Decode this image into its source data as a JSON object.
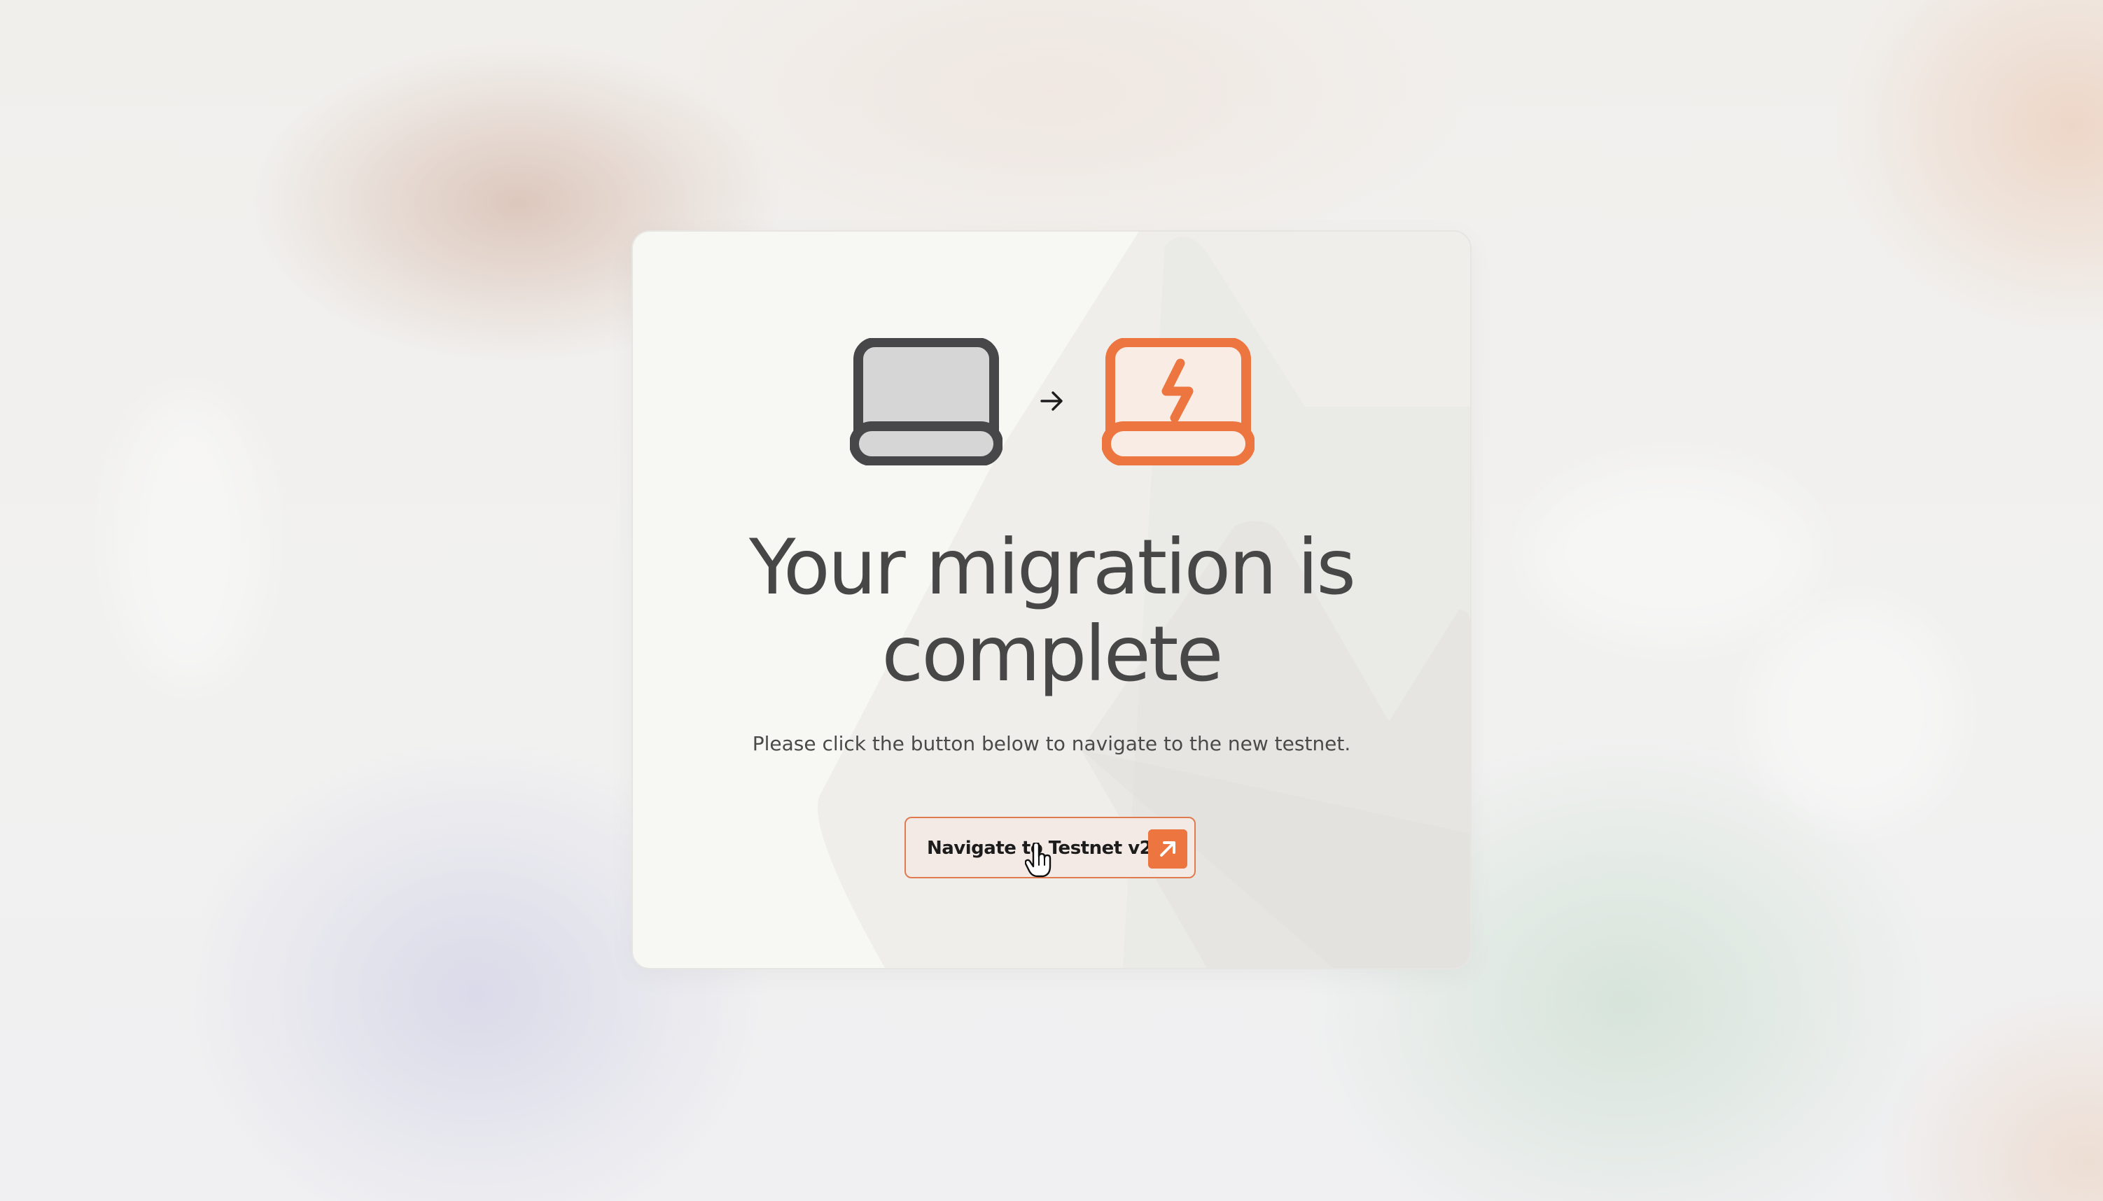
{
  "migration": {
    "title": "Your migration is complete",
    "message": "Please click the button below to navigate to the new testnet.",
    "button_label": "Navigate to Testnet v2",
    "icons": {
      "source": "laptop-icon",
      "arrow": "arrow-right-icon",
      "destination": "laptop-lightning-icon",
      "button_icon": "arrow-up-right-icon"
    }
  },
  "colors": {
    "accent": "#ec7540",
    "text_dark": "#474747",
    "card_background": "#f7f7f3",
    "laptop_old_frame": "#47474a",
    "laptop_old_screen": "#d6d6d6"
  }
}
